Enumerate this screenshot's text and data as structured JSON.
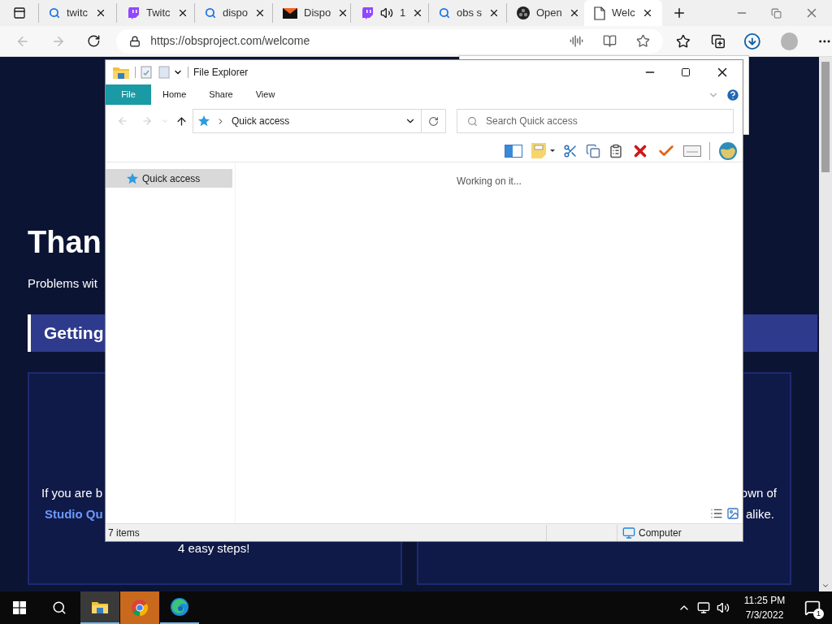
{
  "browser": {
    "tabs": [
      {
        "kind": "search",
        "title": "twitc",
        "selected": false,
        "audio": false
      },
      {
        "kind": "twitch",
        "title": "Twitc",
        "selected": false,
        "audio": false
      },
      {
        "kind": "search",
        "title": "dispo",
        "selected": false,
        "audio": false
      },
      {
        "kind": "mail",
        "title": "Dispo",
        "selected": false,
        "audio": false
      },
      {
        "kind": "twitch",
        "title": "1",
        "selected": false,
        "audio": true
      },
      {
        "kind": "search",
        "title": "obs s",
        "selected": false,
        "audio": false
      },
      {
        "kind": "obs",
        "title": "Open",
        "selected": false,
        "audio": false
      },
      {
        "kind": "page",
        "title": "Welc",
        "selected": true,
        "audio": false
      }
    ],
    "url": "https://obsproject.com/welcome"
  },
  "page": {
    "heading": "Than",
    "subtitle": "Problems wit",
    "banner": "Getting",
    "left_card": {
      "line_1": "If you are b",
      "link": "Studio Qu",
      "line_3": "4 easy steps!"
    },
    "right_card": {
      "line_1": "own of",
      "line_2": "alike."
    }
  },
  "explorer": {
    "title": "File Explorer",
    "ribbon_tabs": [
      {
        "label": "File",
        "selected": true
      },
      {
        "label": "Home",
        "selected": false
      },
      {
        "label": "Share",
        "selected": false
      },
      {
        "label": "View",
        "selected": false
      }
    ],
    "address": "Quick access",
    "search": {
      "placeholder": "Search Quick access"
    },
    "nav_pane": [
      {
        "label": "Quick access",
        "selected": true
      }
    ],
    "message": "Working on it...",
    "status_bar": {
      "items": "7 items",
      "location": "Computer"
    }
  },
  "taskbar": {
    "apps": [
      {
        "kind": "explorer",
        "active": true,
        "flashing": false
      },
      {
        "kind": "chrome",
        "active": false,
        "flashing": true
      },
      {
        "kind": "edge",
        "active": false,
        "flashing": false
      }
    ],
    "time": "11:25 PM",
    "date": "7/3/2022",
    "notifications": "1"
  }
}
